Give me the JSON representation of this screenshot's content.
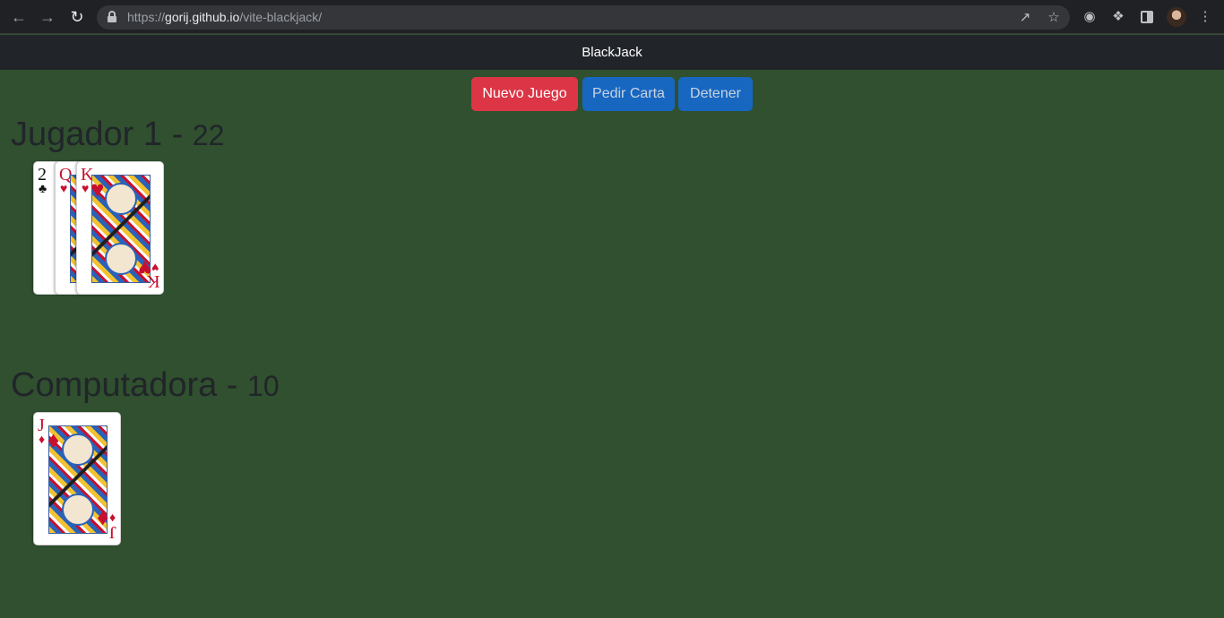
{
  "browser": {
    "url_scheme": "https://",
    "url_host": "gorij.github.io",
    "url_path": "/vite-blackjack/"
  },
  "app": {
    "title": "BlackJack"
  },
  "buttons": {
    "new_game": "Nuevo Juego",
    "hit": "Pedir Carta",
    "stand": "Detener"
  },
  "player": {
    "name": "Jugador 1 - ",
    "score": "22",
    "cards": [
      {
        "rank": "2",
        "suit": "♣",
        "color": "black"
      },
      {
        "rank": "Q",
        "suit": "♥",
        "color": "red"
      },
      {
        "rank": "K",
        "suit": "♥",
        "color": "red"
      }
    ]
  },
  "computer": {
    "name": "Computadora - ",
    "score": "10",
    "cards": [
      {
        "rank": "J",
        "suit": "♦",
        "color": "red"
      }
    ]
  },
  "colors": {
    "table_green": "#30502f",
    "navbar": "#212529",
    "danger": "#dc3545",
    "primary": "#1767c1"
  }
}
